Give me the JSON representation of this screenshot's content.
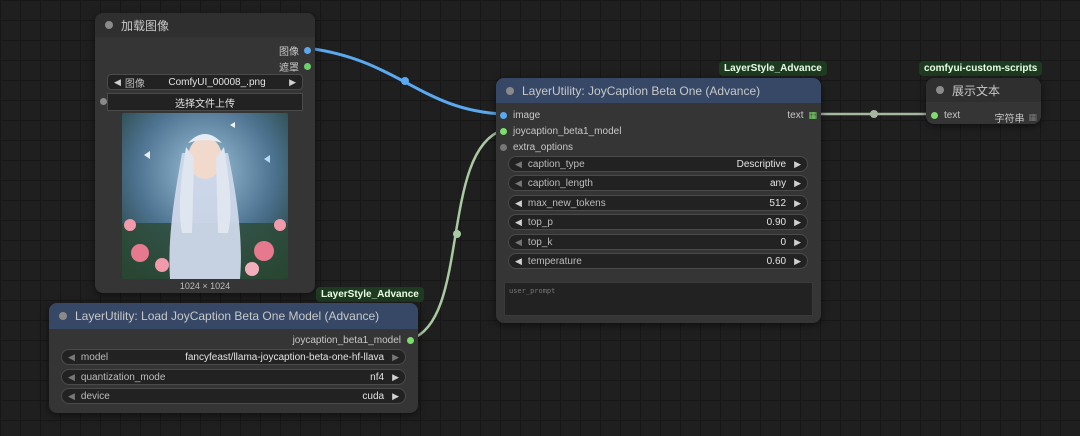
{
  "colors": {
    "image_wire": "#5aa9f0",
    "model_wire": "#a9c9a3",
    "text_wire": "#a5b8a0",
    "image_slot": "#5aa9f0",
    "mask_slot": "#6bd06b",
    "model_slot": "#7ddc6d",
    "badge_bg": "#1e3a20"
  },
  "load_image": {
    "title": "加载图像",
    "out_image": "图像",
    "out_mask": "遮罩",
    "image_label": "图像",
    "image_value": "ComfyUI_00008_.png",
    "upload_button": "选择文件上传",
    "preview_size": "1024 × 1024"
  },
  "load_model": {
    "badge": "LayerStyle_Advance",
    "title": "LayerUtility: Load JoyCaption Beta One Model (Advance)",
    "out_model": "joycaption_beta1_model",
    "widgets": [
      {
        "label": "model",
        "value": "fancyfeast/llama-joycaption-beta-one-hf-llava"
      },
      {
        "label": "quantization_mode",
        "value": "nf4"
      },
      {
        "label": "device",
        "value": "cuda"
      }
    ]
  },
  "joycaption": {
    "badge": "LayerStyle_Advance",
    "title": "LayerUtility: JoyCaption Beta One (Advance)",
    "in_image": "image",
    "in_model": "joycaption_beta1_model",
    "in_extra": "extra_options",
    "out_text": "text",
    "widgets": [
      {
        "label": "caption_type",
        "value": "Descriptive"
      },
      {
        "label": "caption_length",
        "value": "any"
      },
      {
        "label": "max_new_tokens",
        "value": "512"
      },
      {
        "label": "top_p",
        "value": "0.90"
      },
      {
        "label": "top_k",
        "value": "0"
      },
      {
        "label": "temperature",
        "value": "0.60"
      }
    ],
    "user_prompt_placeholder": "user_prompt"
  },
  "show_text": {
    "badge": "comfyui-custom-scripts",
    "title": "展示文本",
    "in_text": "text",
    "type_label": "字符串"
  }
}
